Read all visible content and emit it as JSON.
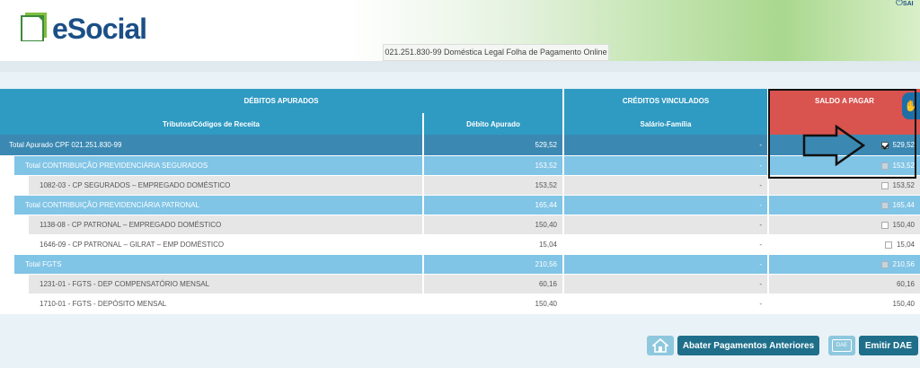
{
  "header": {
    "logo_text": "eSocial",
    "subtitle": "021.251.830-99 Doméstica Legal Folha de Pagamento Online",
    "top_right_label": "SAI"
  },
  "table": {
    "group_headers": {
      "debitos": "DÉBITOS APURADOS",
      "creditos": "CRÉDITOS VINCULADOS",
      "saldo": "SALDO A PAGAR"
    },
    "sub_headers": {
      "tributos": "Tributos/Códigos de Receita",
      "debito": "Débito Apurado",
      "salario_familia": "Salário-Família"
    },
    "rows": [
      {
        "label": "Total Apurado CPF 021.251.830-99",
        "debito": "529,52",
        "credito": "-",
        "saldo": "529,52",
        "level": "total",
        "checked": true
      },
      {
        "label": "Total CONTRIBUIÇÃO PREVIDENCIÁRIA SEGURADOS",
        "debito": "153,52",
        "credito": "-",
        "saldo": "153,52",
        "level": "sub",
        "checked": false
      },
      {
        "label": "1082-03 - CP SEGURADOS – EMPREGADO DOMÉSTICO",
        "debito": "153,52",
        "credito": "-",
        "saldo": "153,52",
        "level": "item",
        "checked": false
      },
      {
        "label": "Total CONTRIBUIÇÃO PREVIDENCIÁRIA PATRONAL",
        "debito": "165,44",
        "credito": "-",
        "saldo": "165,44",
        "level": "sub",
        "checked": false
      },
      {
        "label": "1138-08 - CP PATRONAL – EMPREGADO DOMÉSTICO",
        "debito": "150,40",
        "credito": "-",
        "saldo": "150,40",
        "level": "item",
        "checked": false
      },
      {
        "label": "1646-09 - CP PATRONAL – GILRAT – EMP DOMÉSTICO",
        "debito": "15,04",
        "credito": "-",
        "saldo": "15,04",
        "level": "item",
        "checked": false
      },
      {
        "label": "Total FGTS",
        "debito": "210,56",
        "credito": "-",
        "saldo": "210,56",
        "level": "sub",
        "checked": false
      },
      {
        "label": "1231-01 - FGTS - DEP COMPENSATÓRIO MENSAL",
        "debito": "60,16",
        "credito": "-",
        "saldo": "60,16",
        "level": "item",
        "checked": null
      },
      {
        "label": "1710-01 - FGTS - DEPÓSITO MENSAL",
        "debito": "150,40",
        "credito": "-",
        "saldo": "150,40",
        "level": "item",
        "checked": null
      }
    ]
  },
  "buttons": {
    "abater": "Abater Pagamentos Anteriores",
    "emitir": "Emitir DAE",
    "dae_icon_label": "DAE"
  },
  "colors": {
    "header_blue": "#2f9ac2",
    "total_row": "#3b89b3",
    "sub_row": "#80c4e6",
    "saldo_header": "#d9534f",
    "button": "#1f6f8b"
  }
}
